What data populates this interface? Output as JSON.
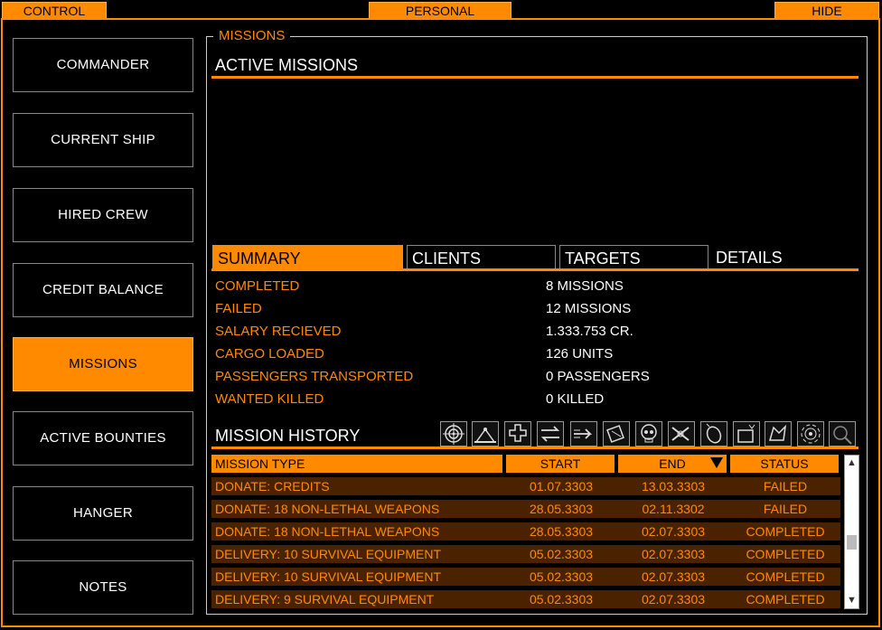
{
  "topbar": {
    "control": "CONTROL",
    "personal": "PERSONAL",
    "hide": "HIDE"
  },
  "sidebar": {
    "items": [
      {
        "label": "COMMANDER",
        "active": false
      },
      {
        "label": "CURRENT SHIP",
        "active": false
      },
      {
        "label": "HIRED CREW",
        "active": false
      },
      {
        "label": "CREDIT BALANCE",
        "active": false
      },
      {
        "label": "MISSIONS",
        "active": true
      },
      {
        "label": "ACTIVE BOUNTIES",
        "active": false
      },
      {
        "label": "HANGER",
        "active": false
      },
      {
        "label": "NOTES",
        "active": false
      }
    ]
  },
  "panel": {
    "legend": "MISSIONS",
    "active_missions_title": "ACTIVE MISSIONS",
    "tabs": [
      "SUMMARY",
      "CLIENTS",
      "TARGETS",
      "DETAILS"
    ],
    "stats": [
      {
        "label": "COMPLETED",
        "value": "8 MISSIONS"
      },
      {
        "label": "FAILED",
        "value": "12 MISSIONS"
      },
      {
        "label": "SALARY RECIEVED",
        "value": "1.333.753 CR."
      },
      {
        "label": "CARGO LOADED",
        "value": "126 UNITS"
      },
      {
        "label": "PASSENGERS TRANSPORTED",
        "value": "0 PASSENGERS"
      },
      {
        "label": "WANTED KILLED",
        "value": "0 KILLED"
      }
    ],
    "history_title": "MISSION HISTORY",
    "filter_icons": [
      "target-icon",
      "landing-icon",
      "medical-icon",
      "trade-icon",
      "courier-icon",
      "cargo-icon",
      "skull-icon",
      "weapons-icon",
      "food-icon",
      "delivery-icon",
      "salvage-icon",
      "radio-icon",
      "survey-icon"
    ],
    "table": {
      "headers": {
        "type": "MISSION TYPE",
        "start": "START",
        "end": "END",
        "status": "STATUS"
      },
      "sort_icon": "sort-down-icon",
      "rows": [
        {
          "type": "DONATE: CREDITS",
          "start": "01.07.3303",
          "end": "13.03.3303",
          "status": "FAILED"
        },
        {
          "type": "DONATE: 18 NON-LETHAL WEAPONS",
          "start": "28.05.3303",
          "end": "02.11.3302",
          "status": "FAILED"
        },
        {
          "type": "DONATE: 18 NON-LETHAL WEAPONS",
          "start": "28.05.3303",
          "end": "02.07.3303",
          "status": "COMPLETED"
        },
        {
          "type": "DELIVERY: 10 SURVIVAL EQUIPMENT",
          "start": "05.02.3303",
          "end": "02.07.3303",
          "status": "COMPLETED"
        },
        {
          "type": "DELIVERY: 10 SURVIVAL EQUIPMENT",
          "start": "05.02.3303",
          "end": "02.07.3303",
          "status": "COMPLETED"
        },
        {
          "type": "DELIVERY: 9 SURVIVAL EQUIPMENT",
          "start": "05.02.3303",
          "end": "02.07.3303",
          "status": "COMPLETED"
        }
      ]
    }
  },
  "colors": {
    "accent": "#ff8a00",
    "row_bg": "#4a2200"
  }
}
